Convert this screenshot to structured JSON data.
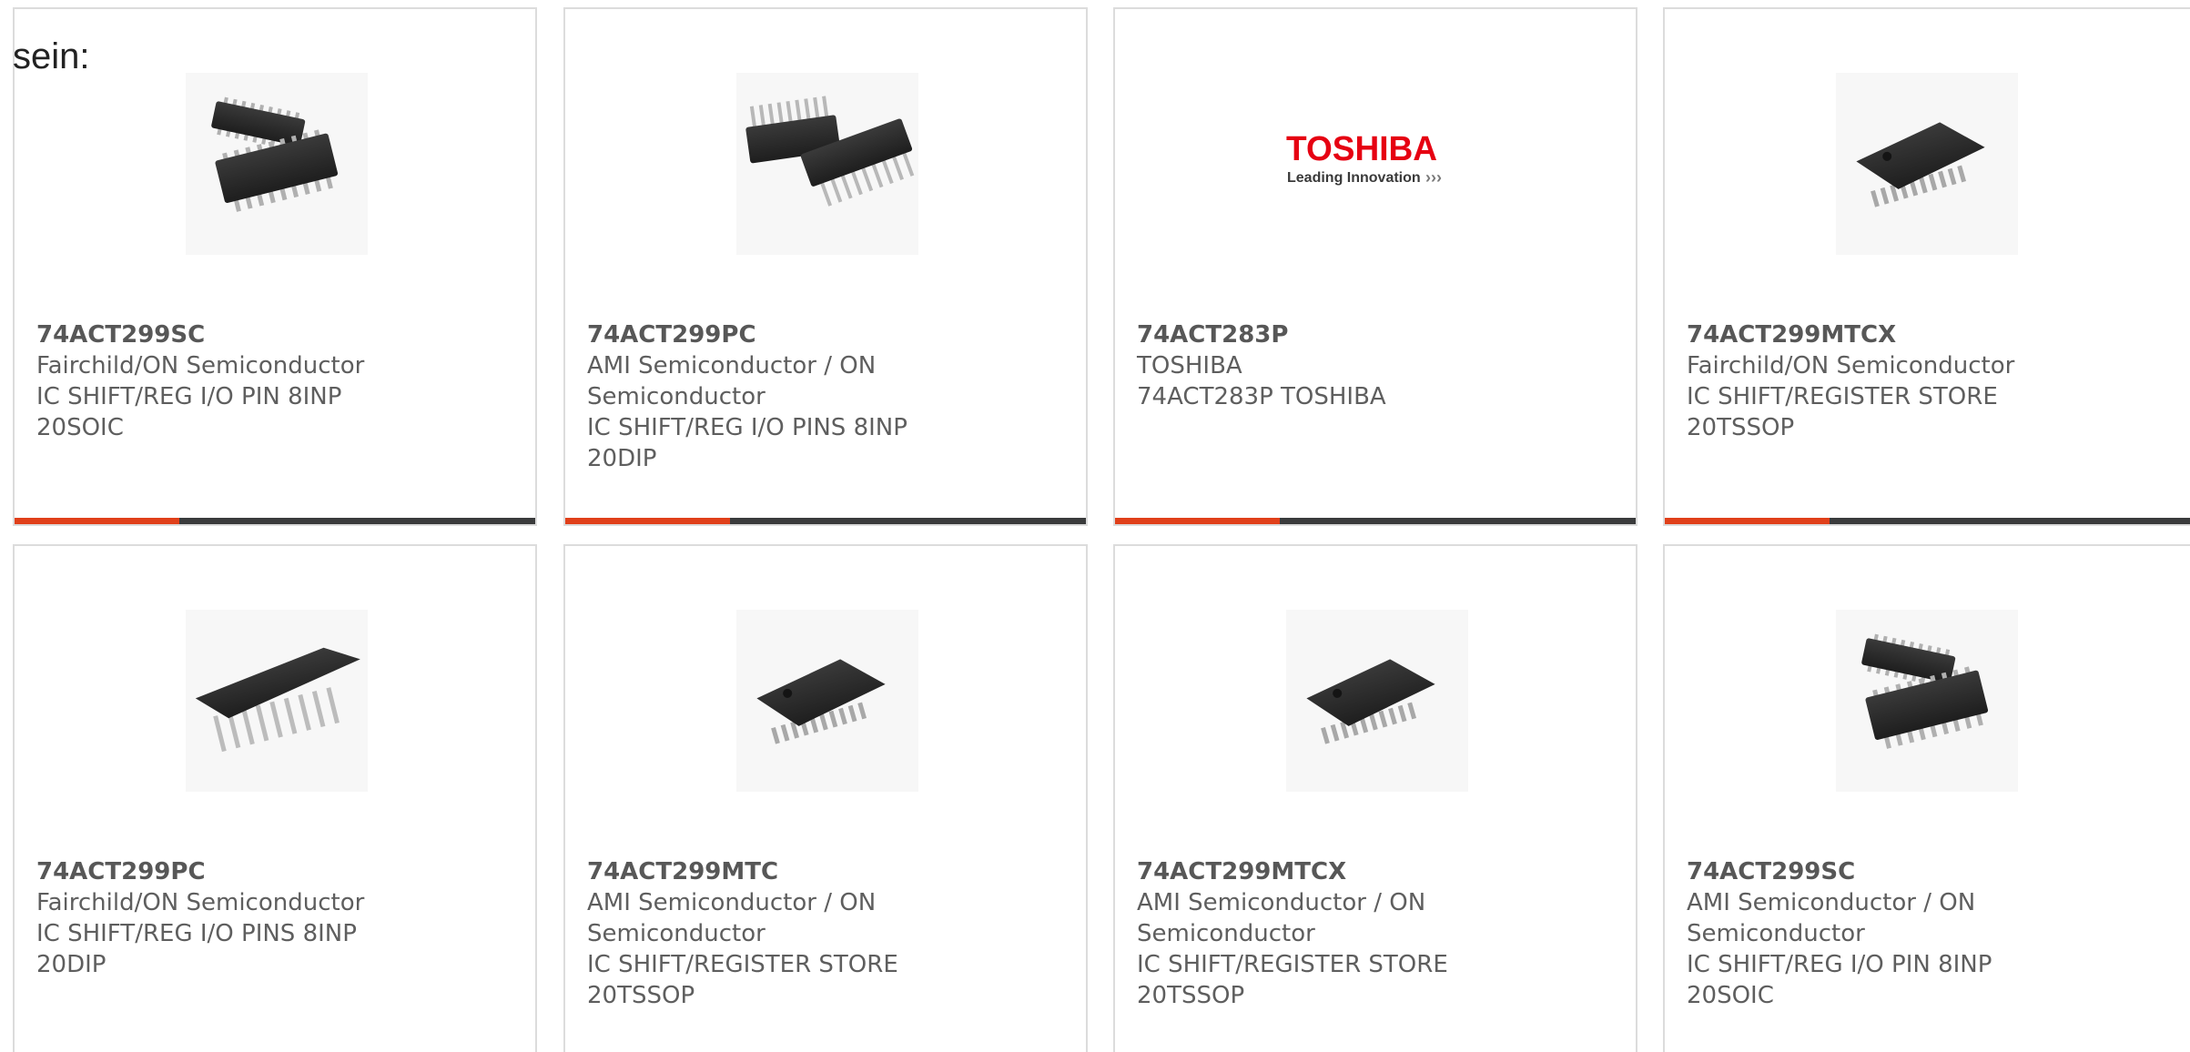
{
  "intro_text": "sein:",
  "colors": {
    "accent": "#e0401a",
    "bar_dark": "#3a3b3c",
    "card_border": "#dcdcdc",
    "text": "#5e5e5e",
    "toshiba_red": "#e60012"
  },
  "products": [
    {
      "part": "74ACT299SC",
      "manufacturer": "Fairchild/ON Semiconductor",
      "description": "IC SHIFT/REG I/O PIN 8INP 20SOIC",
      "image": "soic-pair-chip-image"
    },
    {
      "part": "74ACT299PC",
      "manufacturer": "AMI Semiconductor / ON Semiconductor",
      "description": "IC SHIFT/REG I/O PINS 8INP 20DIP",
      "image": "dip-pair-chip-image"
    },
    {
      "part": "74ACT283P",
      "manufacturer": "TOSHIBA",
      "description": "74ACT283P TOSHIBA",
      "image": "toshiba-logo",
      "logo": {
        "brand": "TOSHIBA",
        "tagline": "Leading Innovation",
        "arrows": "›››"
      }
    },
    {
      "part": "74ACT299MTCX",
      "manufacturer": "Fairchild/ON Semiconductor",
      "description": "IC SHIFT/REGISTER STORE 20TSSOP",
      "image": "tssop-chip-image"
    },
    {
      "part": "74ACT299PC",
      "manufacturer": "Fairchild/ON Semiconductor",
      "description": "IC SHIFT/REG I/O PINS 8INP 20DIP",
      "image": "dip-chip-image"
    },
    {
      "part": "74ACT299MTC",
      "manufacturer": "AMI Semiconductor / ON Semiconductor",
      "description": "IC SHIFT/REGISTER STORE 20TSSOP",
      "image": "tssop-chip-image"
    },
    {
      "part": "74ACT299MTCX",
      "manufacturer": "AMI Semiconductor / ON Semiconductor",
      "description": "IC SHIFT/REGISTER STORE 20TSSOP",
      "image": "tssop-chip-image"
    },
    {
      "part": "74ACT299SC",
      "manufacturer": "AMI Semiconductor / ON Semiconductor",
      "description": "IC SHIFT/REG I/O PIN 8INP 20SOIC",
      "image": "soic-pair-chip-image"
    }
  ]
}
